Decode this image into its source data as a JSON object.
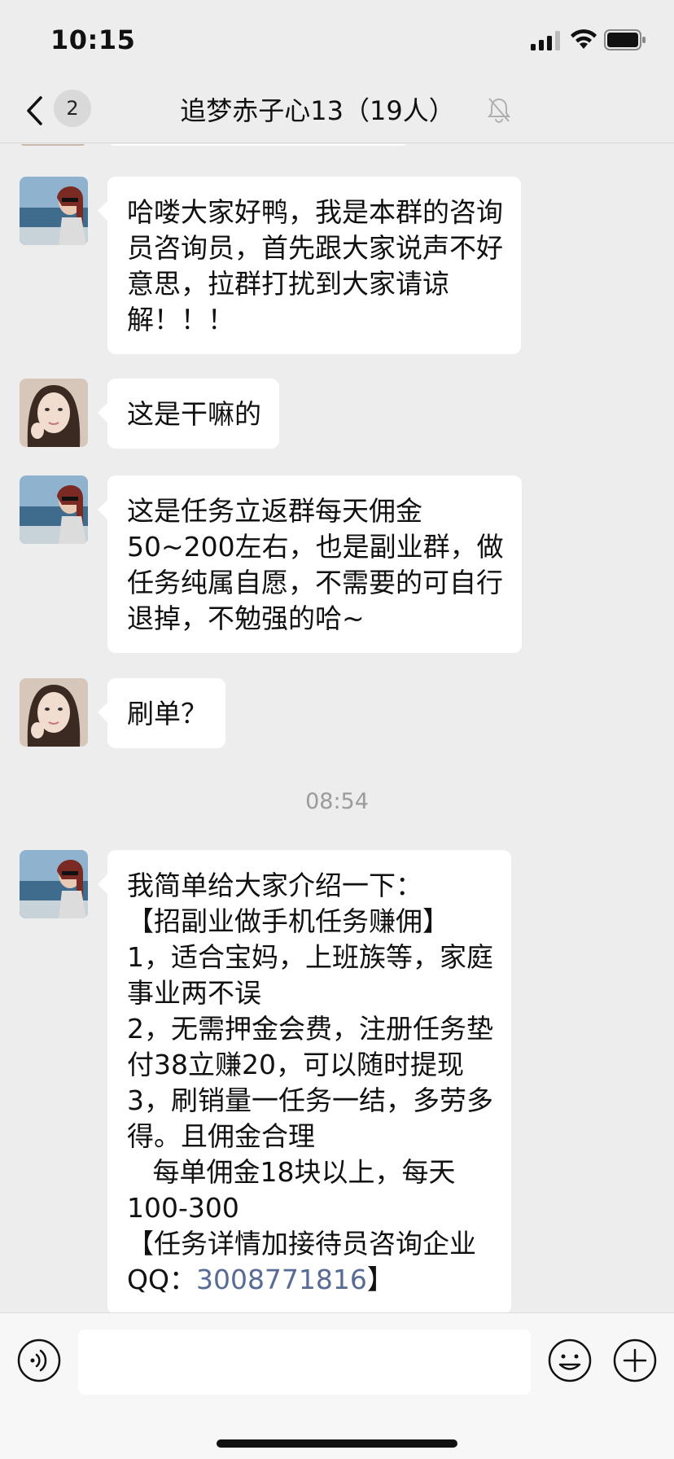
{
  "status": {
    "time": "10:15",
    "icons": [
      "signal-icon",
      "wifi-icon",
      "battery-icon"
    ]
  },
  "nav": {
    "unread_count": "2",
    "title": "追梦赤子心13（19人）",
    "icons": [
      "back-icon",
      "mute-bell-icon"
    ]
  },
  "messages": [
    {
      "sender": "consultant",
      "lines": [
        "哈喽大家好鸭，我是本群的咨询",
        "员咨询员，首先跟大家说声不好",
        "意思，拉群打扰到大家请谅",
        "解！！！"
      ]
    },
    {
      "sender": "member",
      "lines": [
        "这是干嘛的"
      ]
    },
    {
      "sender": "consultant",
      "lines": [
        "这是任务立返群每天佣金",
        "50~200左右，也是副业群，做",
        "任务纯属自愿，不需要的可自行",
        "退掉，不勉强的哈~"
      ]
    },
    {
      "sender": "member",
      "lines": [
        "刷单？"
      ]
    },
    {
      "sender": "consultant",
      "lines": [
        "我简单给大家介绍一下：",
        "【招副业做手机任务赚佣】",
        "1，适合宝妈，上班族等，家庭",
        "事业两不误",
        "2，无需押金会费，注册任务垫",
        "付38立赚20，可以随时提现",
        "3，刷销量一任务一结，多劳多",
        "得。且佣金合理",
        "   每单佣金18块以上，每天",
        "100-300",
        "【任务详情加接待员咨询企业"
      ],
      "qq_prefix": "QQ：",
      "qq_number": "3008771816",
      "qq_suffix": "】"
    }
  ],
  "timestamp": "08:54",
  "input_bar": {
    "placeholder": "",
    "icons": [
      "voice-icon",
      "emoji-icon",
      "plus-icon"
    ]
  },
  "colors": {
    "background": "#ededed",
    "bubble": "#ffffff",
    "link": "#576b95",
    "timestamp": "#9b9b9b"
  }
}
